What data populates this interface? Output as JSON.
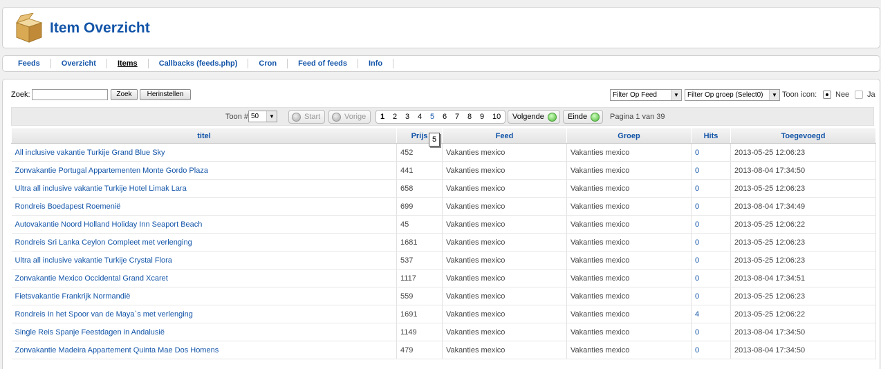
{
  "header": {
    "title": "Item Overzicht",
    "icon": "box-icon"
  },
  "nav": {
    "items": [
      {
        "label": "Feeds"
      },
      {
        "label": "Overzicht"
      },
      {
        "label": "Items",
        "active": true
      },
      {
        "label": "Callbacks (feeds.php)"
      },
      {
        "label": "Cron"
      },
      {
        "label": "Feed of feeds"
      },
      {
        "label": "Info"
      }
    ]
  },
  "toolbar": {
    "search_label": "Zoek:",
    "search_value": "",
    "search_button": "Zoek",
    "reset_button": "Herinstellen",
    "filter_feed": "Filter Op Feed",
    "filter_group": "Filter Op groep (Select0)",
    "show_icon_label": "Toon icon:",
    "no_label": "Nee",
    "yes_label": "Ja",
    "show_icon_selected": "Nee"
  },
  "pager": {
    "show_label": "Toon #",
    "show_value": "50",
    "start": "Start",
    "prev": "Vorige",
    "pages": [
      "1",
      "2",
      "3",
      "4",
      "5",
      "6",
      "7",
      "8",
      "9",
      "10"
    ],
    "current_page": "1",
    "next": "Volgende",
    "end": "Einde",
    "page_info": "Pagina 1 van 39"
  },
  "table": {
    "columns": [
      "titel",
      "Prijs",
      "Feed",
      "Groep",
      "Hits",
      "Toegevoegd"
    ],
    "tooltip": "5",
    "rows": [
      [
        "All inclusive vakantie Turkije Grand Blue Sky",
        "452",
        "Vakanties mexico",
        "Vakanties mexico",
        "0",
        "2013-05-25 12:06:23"
      ],
      [
        "Zonvakantie Portugal Appartementen Monte Gordo Plaza",
        "441",
        "Vakanties mexico",
        "Vakanties mexico",
        "0",
        "2013-08-04 17:34:50"
      ],
      [
        "Ultra all inclusive vakantie Turkije Hotel Limak Lara",
        "658",
        "Vakanties mexico",
        "Vakanties mexico",
        "0",
        "2013-05-25 12:06:23"
      ],
      [
        "Rondreis Boedapest Roemenië",
        "699",
        "Vakanties mexico",
        "Vakanties mexico",
        "0",
        "2013-08-04 17:34:49"
      ],
      [
        "Autovakantie Noord Holland Holiday Inn Seaport Beach",
        "45",
        "Vakanties mexico",
        "Vakanties mexico",
        "0",
        "2013-05-25 12:06:22"
      ],
      [
        "Rondreis Sri Lanka Ceylon Compleet met verlenging",
        "1681",
        "Vakanties mexico",
        "Vakanties mexico",
        "0",
        "2013-05-25 12:06:23"
      ],
      [
        "Ultra all inclusive vakantie Turkije Crystal Flora",
        "537",
        "Vakanties mexico",
        "Vakanties mexico",
        "0",
        "2013-05-25 12:06:23"
      ],
      [
        "Zonvakantie Mexico Occidental Grand Xcaret",
        "1117",
        "Vakanties mexico",
        "Vakanties mexico",
        "0",
        "2013-08-04 17:34:51"
      ],
      [
        "Fietsvakantie Frankrijk Normandië",
        "559",
        "Vakanties mexico",
        "Vakanties mexico",
        "0",
        "2013-05-25 12:06:23"
      ],
      [
        "Rondreis In het Spoor van de Maya`s met verlenging",
        "1691",
        "Vakanties mexico",
        "Vakanties mexico",
        "4",
        "2013-05-25 12:06:22"
      ],
      [
        "Single Reis Spanje Feestdagen in Andalusië",
        "1149",
        "Vakanties mexico",
        "Vakanties mexico",
        "0",
        "2013-08-04 17:34:50"
      ],
      [
        "Zonvakantie Madeira Appartement Quinta Mae Dos Homens",
        "479",
        "Vakanties mexico",
        "Vakanties mexico",
        "0",
        "2013-08-04 17:34:50"
      ]
    ]
  }
}
